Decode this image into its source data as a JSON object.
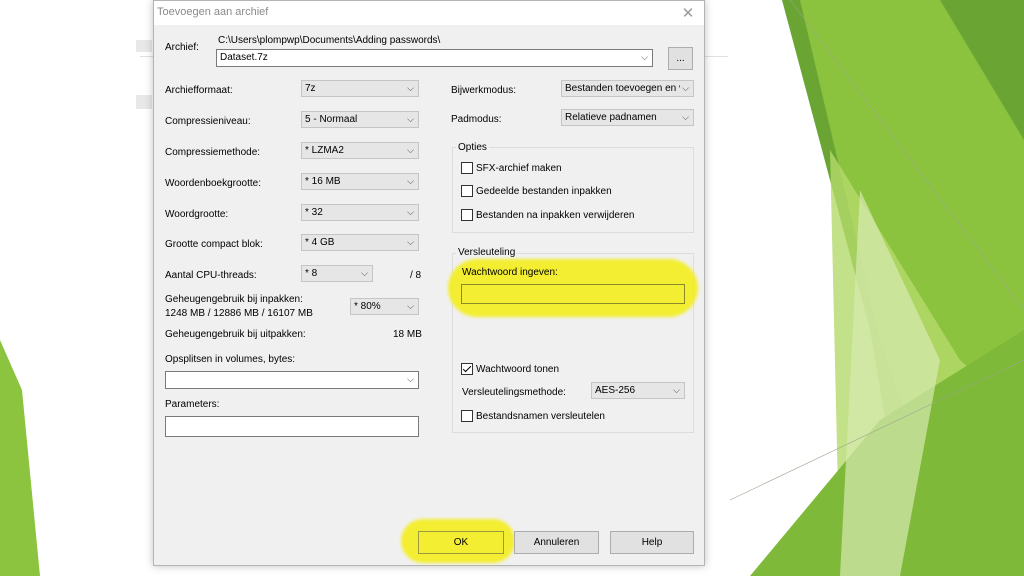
{
  "dialog": {
    "title": "Toevoegen aan archief",
    "close_glyph": "✕"
  },
  "archive": {
    "label": "Archief:",
    "path": "C:\\Users\\plompwp\\Documents\\Adding passwords\\",
    "name": "Dataset.7z",
    "browse_label": "..."
  },
  "left": {
    "format_label": "Archiefformaat:",
    "format_value": "7z",
    "level_label": "Compressieniveau:",
    "level_value": "5 - Normaal",
    "method_label": "Compressiemethode:",
    "method_value": "* LZMA2",
    "dict_label": "Woordenboekgrootte:",
    "dict_value": "* 16 MB",
    "word_label": "Woordgrootte:",
    "word_value": "* 32",
    "solid_label": "Grootte compact blok:",
    "solid_value": "* 4 GB",
    "threads_label": "Aantal CPU-threads:",
    "threads_value": "* 8",
    "threads_max": "/ 8",
    "mem_pack_label": "Geheugengebruik bij inpakken:",
    "mem_pack_detail": "1248 MB / 12886 MB / 16107 MB",
    "mem_pack_value": "* 80%",
    "mem_unpack_label": "Geheugengebruik bij uitpakken:",
    "mem_unpack_value": "18 MB",
    "split_label": "Opsplitsen in volumes, bytes:",
    "split_value": "",
    "params_label": "Parameters:",
    "params_value": ""
  },
  "right": {
    "update_label": "Bijwerkmodus:",
    "update_value": "Bestanden toevoegen en ve",
    "path_label": "Padmodus:",
    "path_value": "Relatieve padnamen",
    "options_title": "Opties",
    "opt_sfx": "SFX-archief maken",
    "opt_shared": "Gedeelde bestanden inpakken",
    "opt_delete": "Bestanden na inpakken verwijderen",
    "enc_title": "Versleuteling",
    "pwd_label": "Wachtwoord ingeven:",
    "pwd_value": "",
    "show_pwd": "Wachtwoord tonen",
    "enc_method_label": "Versleutelingsmethode:",
    "enc_method_value": "AES-256",
    "enc_names": "Bestandsnamen versleutelen"
  },
  "buttons": {
    "ok": "OK",
    "cancel": "Annuleren",
    "help": "Help"
  },
  "colors": {
    "highlight": "#f4ee10",
    "green_dark": "#5f9b2e",
    "green_light": "#a8d05a"
  }
}
